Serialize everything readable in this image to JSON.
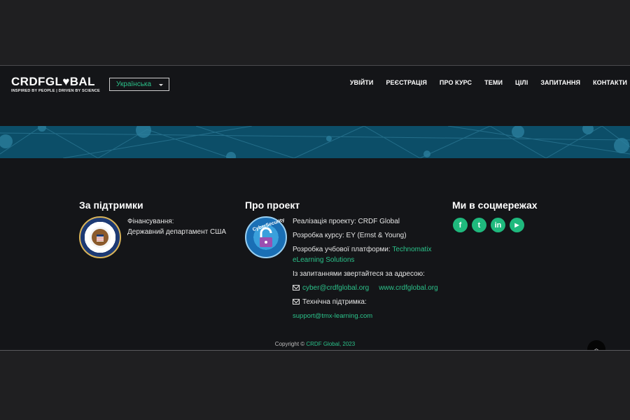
{
  "header": {
    "logo_main": "CRDFGL♥BAL",
    "logo_sub": "INSPIRED BY PEOPLE | DRIVEN BY SCIENCE",
    "language": "Українська",
    "nav": [
      "УВІЙТИ",
      "РЕЄСТРАЦІЯ",
      "ПРО КУРС",
      "ТЕМИ",
      "ЦІЛІ",
      "ЗАПИТАННЯ",
      "КОНТАКТИ"
    ]
  },
  "support": {
    "title": "За підтримки",
    "funding_label": "Фінансування:",
    "funder": "Державний департамент США",
    "seal_icon": "us-state-department-seal"
  },
  "project": {
    "title": "Про проект",
    "badge_icon": "cyber-security-lock",
    "badge_text": "CyberSecurity",
    "implementation": "Реалізація проекту: CRDF Global",
    "course_dev": "Розробка курсу: EY (Ernst & Young)",
    "platform_prefix": "Розробка учбової платформи: ",
    "platform_link": "Technomatix eLearning Solutions",
    "contact_prompt": "Із запитаннями звертайтеся за адресою:",
    "email": "cyber@crdfglobal.org",
    "website": "www.crdfglobal.org",
    "support_label": "Технічна підтримка:",
    "support_email": "support@tmx-learning.com"
  },
  "social": {
    "title": "Ми в соцмережах",
    "icons": [
      "facebook-icon",
      "twitter-icon",
      "linkedin-icon",
      "youtube-icon"
    ],
    "glyphs": [
      "f",
      "t",
      "in",
      "▶"
    ]
  },
  "footer": {
    "copyright_prefix": "Copyright © ",
    "copyright_link": "CRDF Global, 2023"
  },
  "colors": {
    "accent": "#2bc28a",
    "banner": "#0c4e68",
    "background": "#141518"
  }
}
